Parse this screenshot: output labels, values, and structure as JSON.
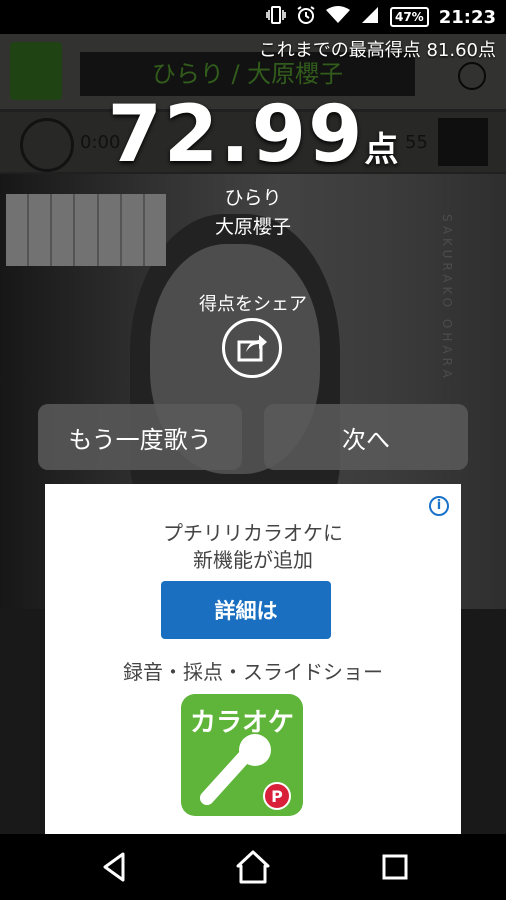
{
  "status_bar": {
    "battery": "47%",
    "time": "21:23"
  },
  "background": {
    "song_bar_text": "ひらり / 大原櫻子",
    "elapsed": "0:00",
    "number": "55",
    "vertical_text": "SAKURAKO OHARA"
  },
  "result": {
    "best_score_label": "これまでの最高得点 81.60点",
    "score": "72.99",
    "score_unit": "点",
    "song_title": "ひらり",
    "artist": "大原櫻子",
    "share_label": "得点をシェア",
    "sing_again_label": "もう一度歌う",
    "next_label": "次へ"
  },
  "ad": {
    "info": "i",
    "line1": "プチリリカラオケに",
    "line2": "新機能が追加",
    "button_label": "詳細は",
    "line3": "録音・採点・スライドショー",
    "icon_text": "カラオケ"
  },
  "colors": {
    "ad_button": "#1a6fc0",
    "app_green": "#5fb43a",
    "mic_badge": "#d8203a"
  }
}
